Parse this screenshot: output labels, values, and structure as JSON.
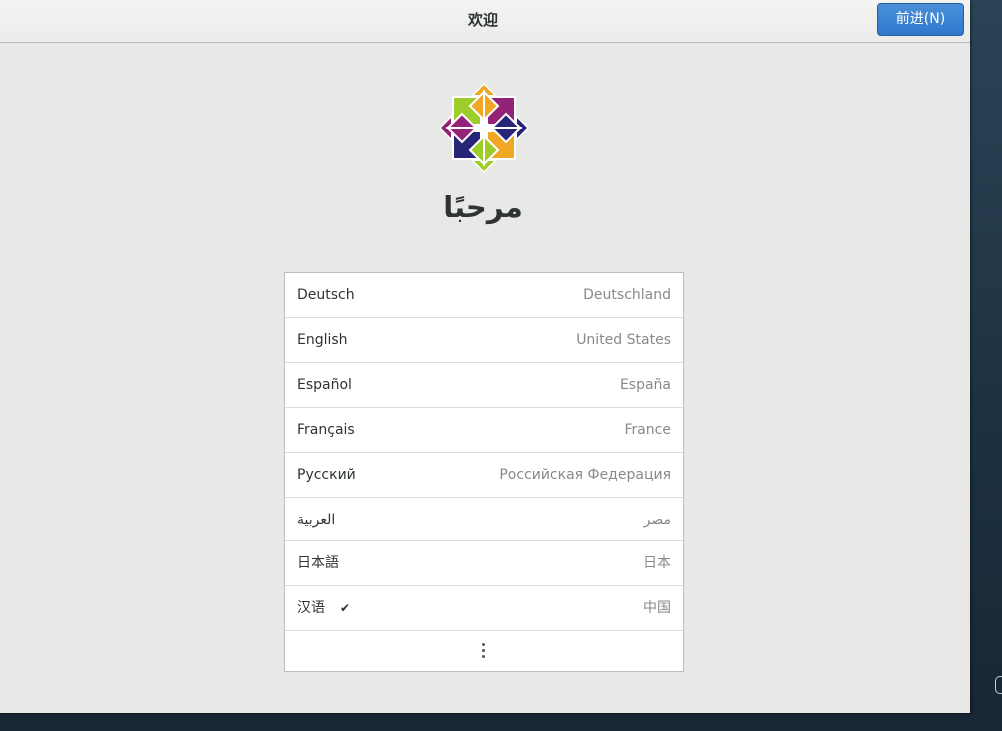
{
  "window": {
    "title": "欢迎"
  },
  "header": {
    "next_button_label": "前进(N)"
  },
  "welcome": {
    "greeting": "مرحبًا"
  },
  "languages": [
    {
      "name": "Deutsch",
      "region": "Deutschland",
      "selected": false
    },
    {
      "name": "English",
      "region": "United States",
      "selected": false
    },
    {
      "name": "Español",
      "region": "España",
      "selected": false
    },
    {
      "name": "Français",
      "region": "France",
      "selected": false
    },
    {
      "name": "Русский",
      "region": "Российская Федерация",
      "selected": false
    },
    {
      "name": "العربية",
      "region": "مصر",
      "selected": false
    },
    {
      "name": "日本語",
      "region": "日本",
      "selected": false
    },
    {
      "name": "汉语",
      "region": "中国",
      "selected": true
    }
  ],
  "icons": {
    "logo": "centos-logo-icon",
    "selected": "checkmark-icon",
    "more": "more-vertical-icon"
  },
  "colors": {
    "button": "#3584e4",
    "logo_purple": "#932279",
    "logo_green": "#9ccd2a",
    "logo_orange": "#efa724",
    "logo_navy": "#262577"
  }
}
